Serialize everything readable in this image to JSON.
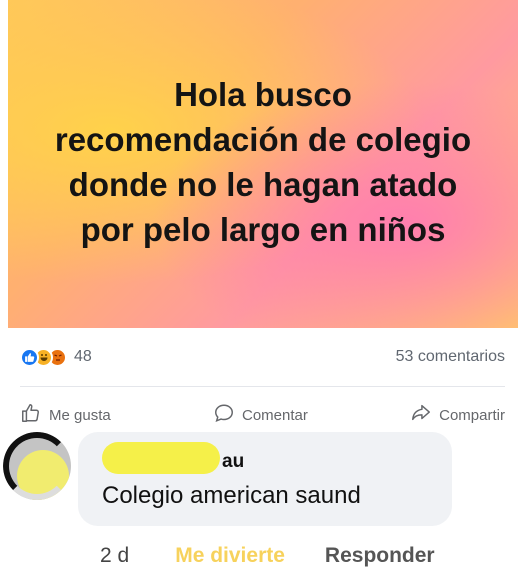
{
  "post": {
    "text": "Hola busco recomendación de colegio donde no le hagan atado por pelo largo en niños"
  },
  "stats": {
    "reaction_icons": [
      "like-icon",
      "haha-icon",
      "angry-icon"
    ],
    "reaction_count": "48",
    "comments_count": "53 comentarios"
  },
  "actions": {
    "like_label": "Me gusta",
    "comment_label": "Comentar",
    "share_label": "Compartir"
  },
  "comment": {
    "author_visible_suffix": "au",
    "text": "Colegio american saund",
    "time": "2 d",
    "reaction_label": "Me divierte",
    "reply_label": "Responder"
  },
  "colors": {
    "banner_accent_pink": "#ff7fae",
    "banner_accent_yellow": "#ffd24a",
    "redaction_yellow": "#f5f049",
    "funny_reaction_yellow": "#f7d25c"
  }
}
